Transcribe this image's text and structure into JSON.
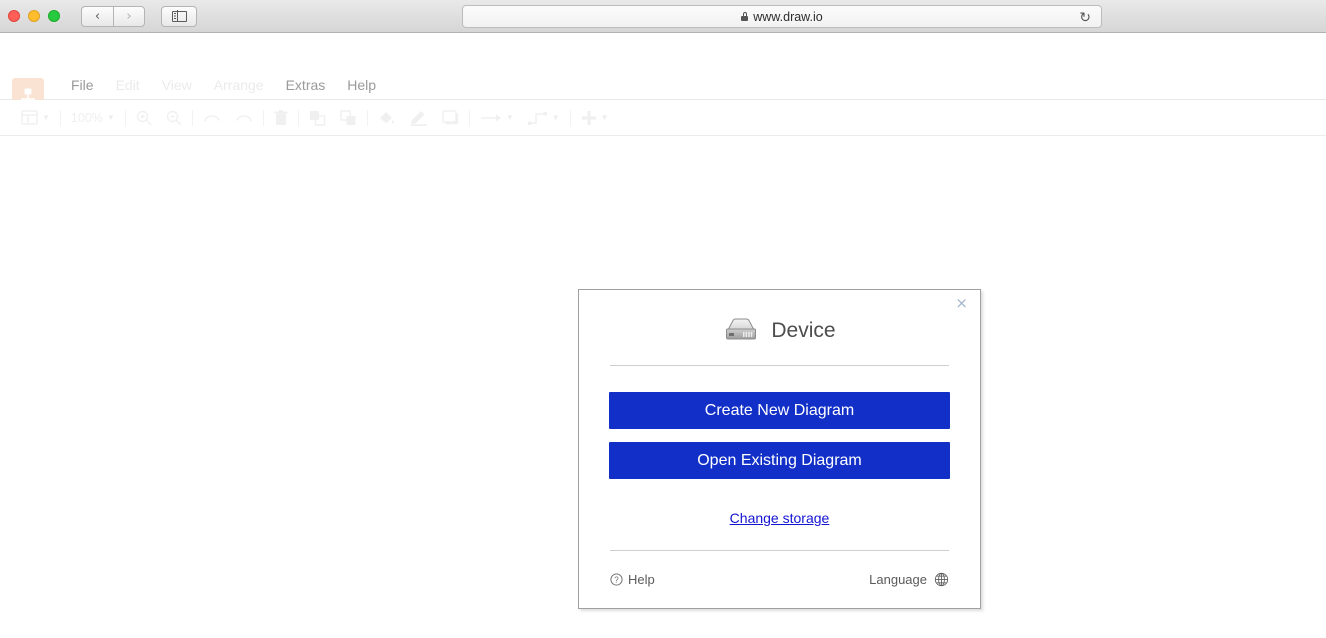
{
  "browser": {
    "traffic_lights": [
      {
        "name": "close",
        "color": "#ff5f56"
      },
      {
        "name": "minimize",
        "color": "#ffbd2e"
      },
      {
        "name": "maximize",
        "color": "#27c93f"
      }
    ],
    "back_label": "‹",
    "forward_label": "›",
    "sidebar_icon": "sidebar-icon",
    "url": "www.draw.io",
    "lock_icon": "lock-icon",
    "reload_label": "↻"
  },
  "app": {
    "logo_name": "drawio-logo",
    "menu": [
      {
        "label": "File",
        "disabled": false
      },
      {
        "label": "Edit",
        "disabled": true
      },
      {
        "label": "View",
        "disabled": true
      },
      {
        "label": "Arrange",
        "disabled": true
      },
      {
        "label": "Extras",
        "disabled": false
      },
      {
        "label": "Help",
        "disabled": false
      }
    ],
    "toolbar": {
      "zoom_level": "100%",
      "items": [
        "view-layout-icon",
        "zoom-in-icon",
        "zoom-out-icon",
        "undo-icon",
        "redo-icon",
        "delete-icon",
        "to-front-icon",
        "to-back-icon",
        "fill-color-icon",
        "line-color-icon",
        "shadow-icon",
        "waypoints-icon",
        "edge-style-icon",
        "insert-icon"
      ]
    }
  },
  "dialog": {
    "close_label": "×",
    "storage_icon": "device-hard-drive-icon",
    "title": "Device",
    "create_button": "Create New Diagram",
    "open_button": "Open Existing Diagram",
    "change_storage_link": "Change storage",
    "help_label": "Help",
    "help_icon": "question-circle-icon",
    "language_label": "Language",
    "language_icon": "globe-icon",
    "accent_color": "#1230c8",
    "link_color": "#1414d2"
  }
}
